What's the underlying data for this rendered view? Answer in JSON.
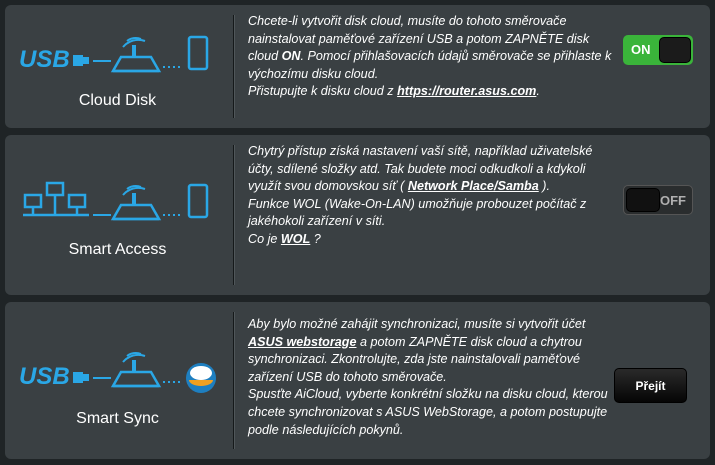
{
  "features": [
    {
      "title": "Cloud Disk",
      "icons": [
        "usb-icon",
        "router-icon",
        "phone-icon"
      ],
      "usb_text": "USB",
      "desc": {
        "t1": "Chcete-li vytvořit disk cloud, musíte do tohoto směrovače nainstalovat paměťové zařízení USB a potom ZAPNĚTE disk cloud ",
        "on_word": "ON",
        "t2": ".  Pomocí přihlašovacích údajů směrovače se přihlaste k výchozímu disku cloud.",
        "t3": "Přistupujte k disku cloud z ",
        "link": "https://router.asus.com",
        "t4": "."
      },
      "control": {
        "type": "toggle",
        "state": "on",
        "label": "ON"
      }
    },
    {
      "title": "Smart Access",
      "icons": [
        "network-icon",
        "router-icon",
        "phone-icon"
      ],
      "desc": {
        "t1": "Chytrý přístup získá nastavení vaší sítě, například uživatelské účty, sdílené složky atd. Tak budete moci odkudkoli a kdykoli využít svou domovskou síť ( ",
        "link1": "Network Place/Samba",
        "t2": " ).",
        "t3": "Funkce WOL (Wake-On-LAN) umožňuje probouzet počítač z jakéhokoli zařízení v síti.",
        "t4": "Co je ",
        "link2": "WOL",
        "t5": " ?"
      },
      "control": {
        "type": "toggle",
        "state": "off",
        "label": "OFF"
      }
    },
    {
      "title": "Smart Sync",
      "icons": [
        "usb-icon",
        "router-icon",
        "cloud-sync-icon"
      ],
      "usb_text": "USB",
      "desc": {
        "t1": "Aby bylo možné zahájit synchronizaci, musíte si vytvořit účet ",
        "link": "ASUS webstorage",
        "t2": " a potom ZAPNĚTE disk cloud a chytrou synchronizaci. Zkontrolujte, zda jste nainstalovali paměťové zařízení USB do tohoto směrovače.",
        "t3": "Spusťte AiCloud, vyberte konkrétní složku na disku cloud, kterou chcete synchronizovat s ASUS WebStorage, a potom postupujte podle následujících pokynů."
      },
      "control": {
        "type": "button",
        "label": "Přejít"
      }
    }
  ],
  "colors": {
    "accent_blue": "#2aa7e6",
    "toggle_on": "#3ab43a",
    "panel": "#3a4043",
    "background": "#1f2426"
  }
}
